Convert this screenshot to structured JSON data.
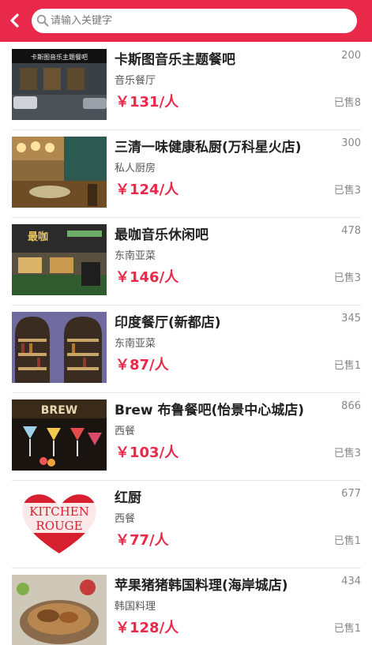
{
  "search": {
    "placeholder": "请输入关键字"
  },
  "restaurants": [
    {
      "name": "卡斯图音乐主题餐吧",
      "category": "音乐餐厅",
      "price": "￥131/人",
      "count": "200",
      "sold": "已售8",
      "thumb_sign": "卡斯图音乐主题餐吧"
    },
    {
      "name": "三清一味健康私厨(万科星火店)",
      "category": "私人厨房",
      "price": "￥124/人",
      "count": "300",
      "sold": "已售3"
    },
    {
      "name": "最咖音乐休闲吧",
      "category": "东南亚菜",
      "price": "￥146/人",
      "count": "478",
      "sold": "已售3",
      "thumb_sign": "最咖"
    },
    {
      "name": "印度餐厅(新都店)",
      "category": "东南亚菜",
      "price": "￥87/人",
      "count": "345",
      "sold": "已售1"
    },
    {
      "name": "Brew 布鲁餐吧(怡景中心城店)",
      "category": "西餐",
      "price": "￥103/人",
      "count": "866",
      "sold": "已售3",
      "thumb_sign": "BREW"
    },
    {
      "name": "红厨",
      "category": "西餐",
      "price": "￥77/人",
      "count": "677",
      "sold": "已售1",
      "thumb_sign": [
        "KITCHEN",
        "ROUGE"
      ]
    },
    {
      "name": "苹果猪猪韩国料理(海岸城店)",
      "category": "韩国料理",
      "price": "￥128/人",
      "count": "434",
      "sold": "已售1"
    }
  ],
  "colors": {
    "accent": "#e8294a",
    "price": "#e8294a",
    "muted": "#888888"
  },
  "icons": {
    "back": "chevron-left-icon",
    "search": "search-icon"
  }
}
